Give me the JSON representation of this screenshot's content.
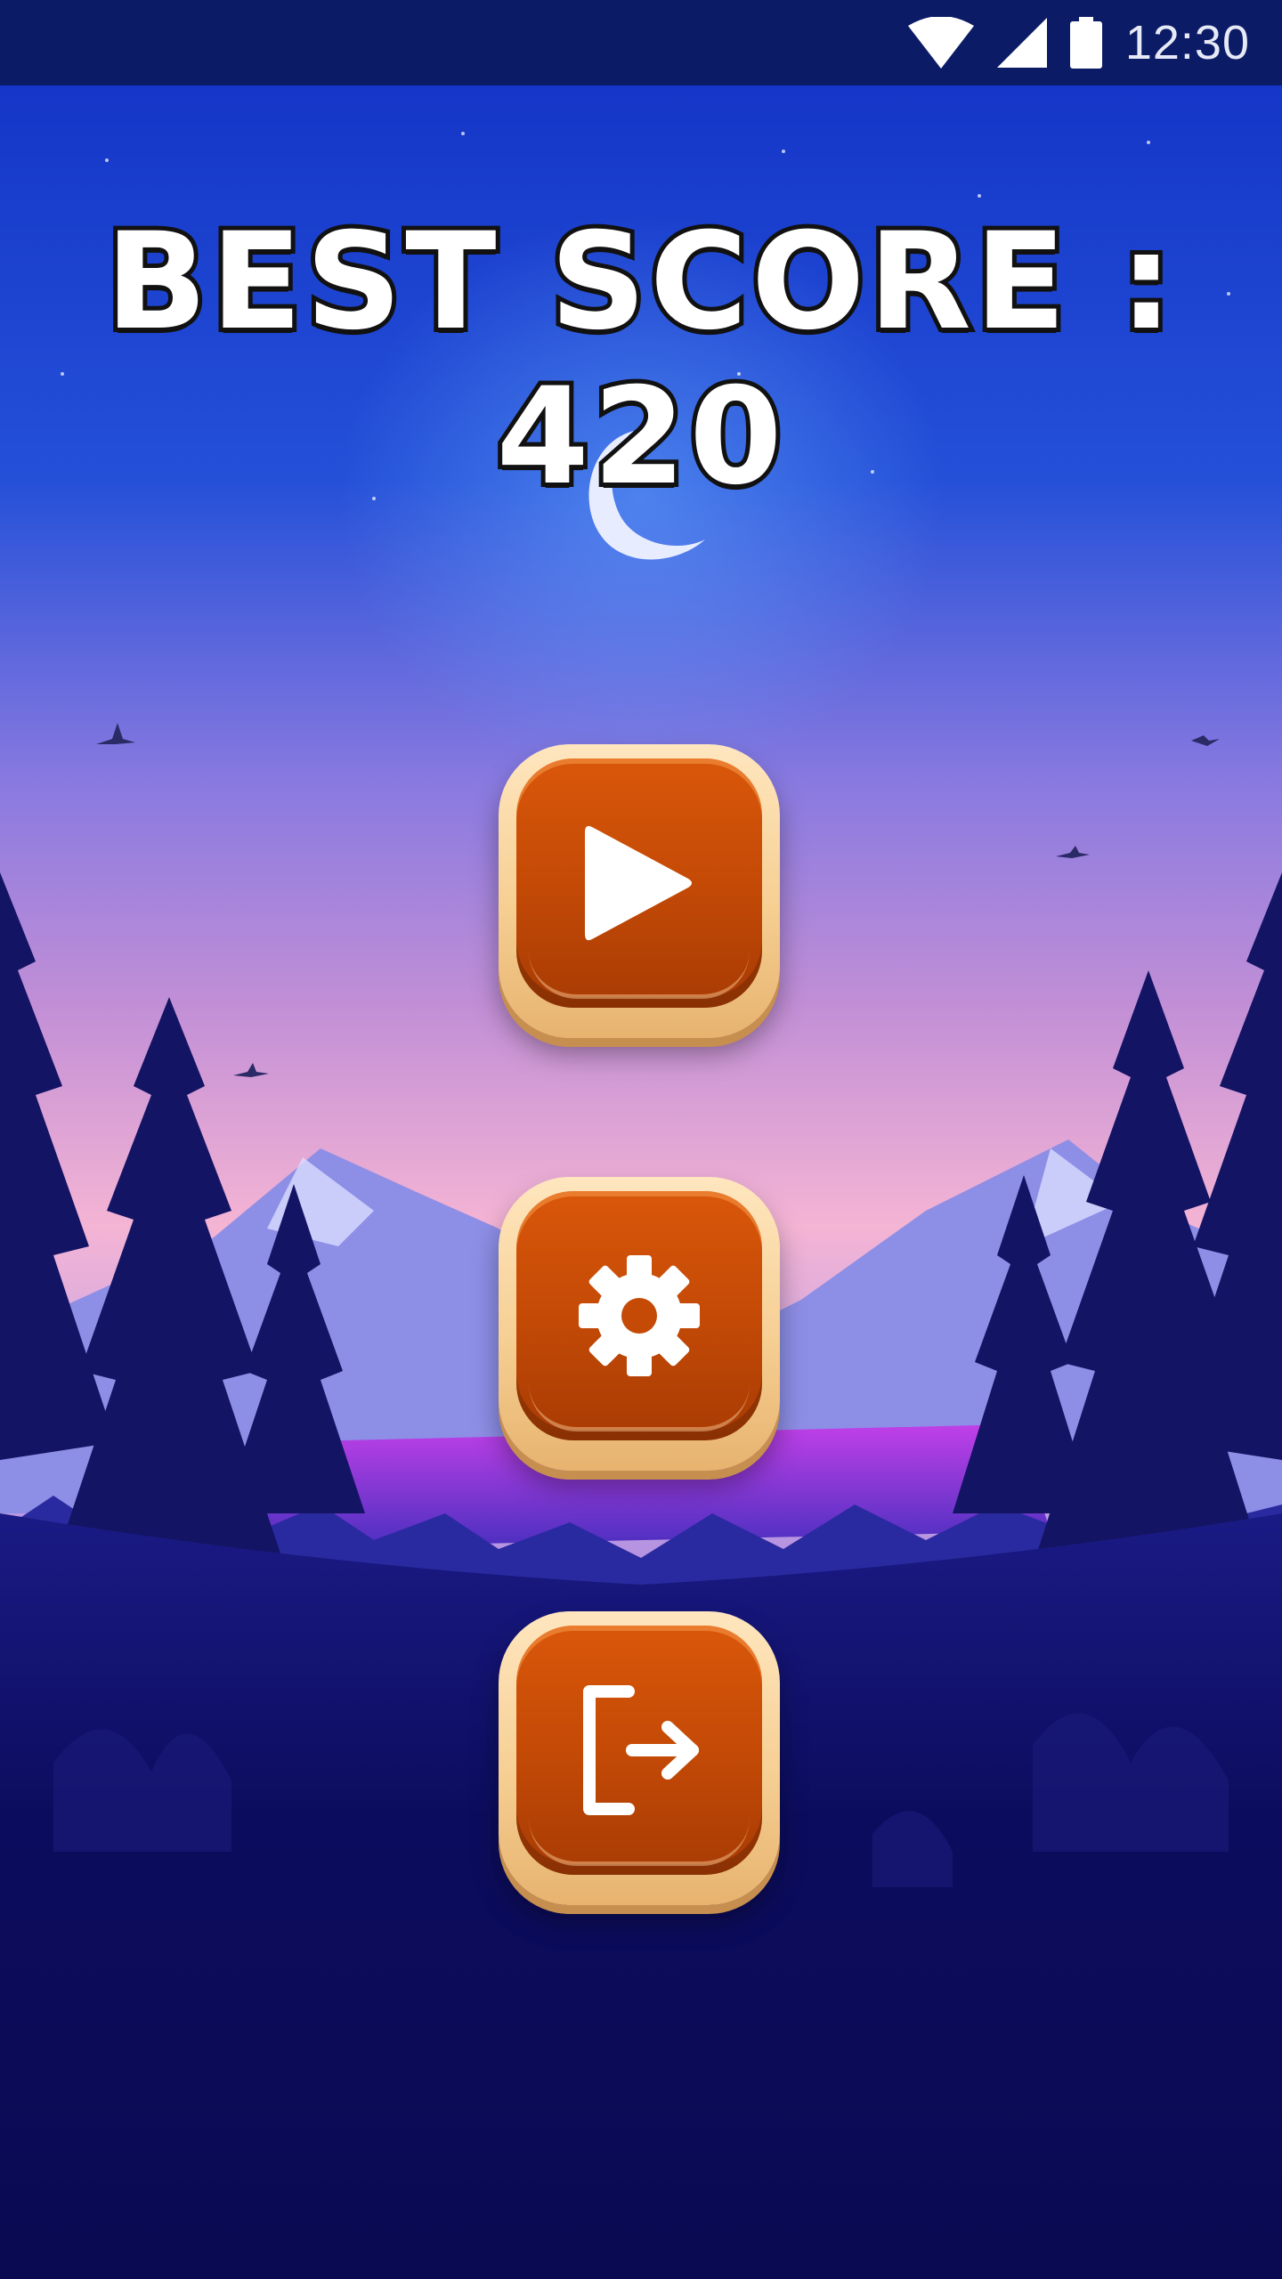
{
  "status_bar": {
    "time": "12:30",
    "icons": [
      "wifi-icon",
      "cell-signal-icon",
      "battery-icon"
    ]
  },
  "title": {
    "text": "BEST SCORE : 420"
  },
  "menu": {
    "buttons": [
      {
        "name": "play",
        "icon": "play-icon"
      },
      {
        "name": "settings",
        "icon": "gear-icon"
      },
      {
        "name": "exit",
        "icon": "exit-icon"
      }
    ]
  },
  "colors": {
    "status_bar": "#0c1b66",
    "sky_top": "#1a3fd6",
    "sky_mid": "#b07fd8",
    "horizon_pink": "#f4b4d4",
    "button_orange": "#c44a06",
    "button_frame": "#f6cf93",
    "forest_dark": "#0a0a52"
  }
}
